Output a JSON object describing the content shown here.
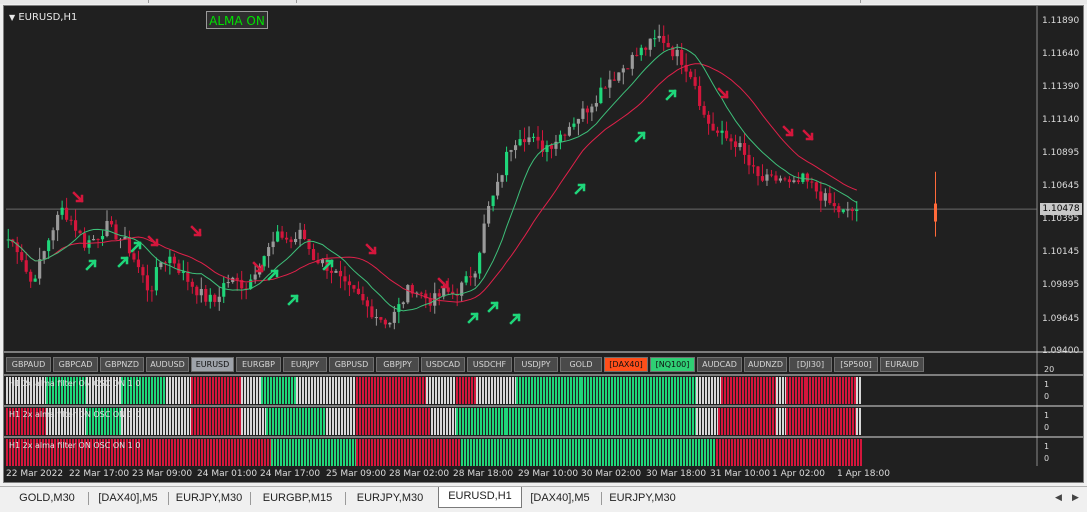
{
  "window": {
    "symbol_label": "EURUSD,H1",
    "alma_badge": "ALMA ON",
    "current_price": "1.10478"
  },
  "price_axis": [
    "1.11890",
    "1.11640",
    "1.11390",
    "1.11140",
    "1.10895",
    "1.10645",
    "1.10395",
    "1.10145",
    "1.09895",
    "1.09645",
    "1.09400"
  ],
  "symbol_buttons": [
    {
      "label": "GBPAUD",
      "state": "normal"
    },
    {
      "label": "GBPCAD",
      "state": "normal"
    },
    {
      "label": "GBPNZD",
      "state": "normal"
    },
    {
      "label": "AUDUSD",
      "state": "normal"
    },
    {
      "label": "EURUSD",
      "state": "active"
    },
    {
      "label": "EURGBP",
      "state": "normal"
    },
    {
      "label": "EURJPY",
      "state": "normal"
    },
    {
      "label": "GBPUSD",
      "state": "normal"
    },
    {
      "label": "GBPJPY",
      "state": "normal"
    },
    {
      "label": "USDCAD",
      "state": "normal"
    },
    {
      "label": "USDCHF",
      "state": "normal"
    },
    {
      "label": "USDJPY",
      "state": "normal"
    },
    {
      "label": "GOLD",
      "state": "normal"
    },
    {
      "label": "[DAX40]",
      "state": "orange"
    },
    {
      "label": "[NQ100]",
      "state": "green"
    },
    {
      "label": "AUDCAD",
      "state": "normal"
    },
    {
      "label": "AUDNZD",
      "state": "normal"
    },
    {
      "label": "[DJI30]",
      "state": "normal"
    },
    {
      "label": "[SP500]",
      "state": "normal"
    },
    {
      "label": "EURAUD",
      "state": "normal"
    }
  ],
  "indicator_panes": [
    {
      "label": "H1  2x alma  filter  ON  OSC  ON  1 0",
      "scale_top": "1",
      "scale_bottom": "0",
      "axis_extra": "20"
    },
    {
      "label": "H1  2x alma  filter  ON  OSC  ON  1 0",
      "scale_top": "1",
      "scale_bottom": "0",
      "axis_extra": ""
    },
    {
      "label": "H1  2x alma  filter  ON  OSC  ON  1 0",
      "scale_top": "1",
      "scale_bottom": "0",
      "axis_extra": ""
    }
  ],
  "time_axis": [
    "22 Mar 2022",
    "22 Mar 17:00",
    "23 Mar 09:00",
    "24 Mar 01:00",
    "24 Mar 17:00",
    "25 Mar 09:00",
    "28 Mar 02:00",
    "28 Mar 18:00",
    "29 Mar 10:00",
    "30 Mar 02:00",
    "30 Mar 18:00",
    "31 Mar 10:00",
    "1 Apr 02:00",
    "1 Apr 18:00"
  ],
  "tabs": [
    {
      "label": "GOLD,M30",
      "active": false
    },
    {
      "label": "[DAX40],M5",
      "active": false
    },
    {
      "label": "EURJPY,M30",
      "active": false
    },
    {
      "label": "EURGBP,M15",
      "active": false
    },
    {
      "label": "EURJPY,M30",
      "active": false
    },
    {
      "label": "EURUSD,H1",
      "active": true
    },
    {
      "label": "[DAX40],M5",
      "active": false
    },
    {
      "label": "EURJPY,M30",
      "active": false
    }
  ],
  "colors": {
    "background": "#202020",
    "bull": "#1fd67a",
    "bear": "#d4163c",
    "neutral": "#d8d8d8",
    "alma_slow": "#e0204a",
    "alma_fast": "#3ec07a",
    "button_orange": "#ff4e1a",
    "button_green": "#2fcf74"
  },
  "chart_data": {
    "type": "candlestick",
    "symbol": "EURUSD",
    "timeframe": "H1",
    "ylim": [
      1.094,
      1.1195
    ],
    "last_price": 1.10478,
    "close_path": [
      1.1025,
      1.1018,
      1.0992,
      1.1008,
      1.1032,
      1.1048,
      1.1037,
      1.1022,
      1.1026,
      1.1035,
      1.1028,
      1.102,
      1.1003,
      1.0985,
      1.1008,
      1.1012,
      1.0999,
      1.099,
      1.0981,
      1.0978,
      1.0994,
      1.0993,
      1.099,
      1.1008,
      1.1018,
      1.1029,
      1.1023,
      1.103,
      1.1012,
      1.1007,
      1.1,
      1.0988,
      1.0983,
      1.0974,
      1.0967,
      1.0962,
      1.0975,
      1.099,
      1.0983,
      1.0978,
      1.0985,
      1.0984,
      1.0992,
      1.1005,
      1.1045,
      1.1065,
      1.1093,
      1.1105,
      1.1101,
      1.1094,
      1.1098,
      1.1106,
      1.1115,
      1.1122,
      1.1132,
      1.1145,
      1.115,
      1.1159,
      1.1166,
      1.1172,
      1.1178,
      1.1168,
      1.116,
      1.1147,
      1.1117,
      1.1106,
      1.1101,
      1.1098,
      1.1082,
      1.107,
      1.1069,
      1.1071,
      1.1064,
      1.107,
      1.1064,
      1.1056,
      1.1048,
      1.1044,
      1.1048
    ],
    "series": [
      {
        "name": "ALMA slow",
        "color": "#e0204a"
      },
      {
        "name": "ALMA fast",
        "color": "#3ec07a"
      }
    ]
  }
}
